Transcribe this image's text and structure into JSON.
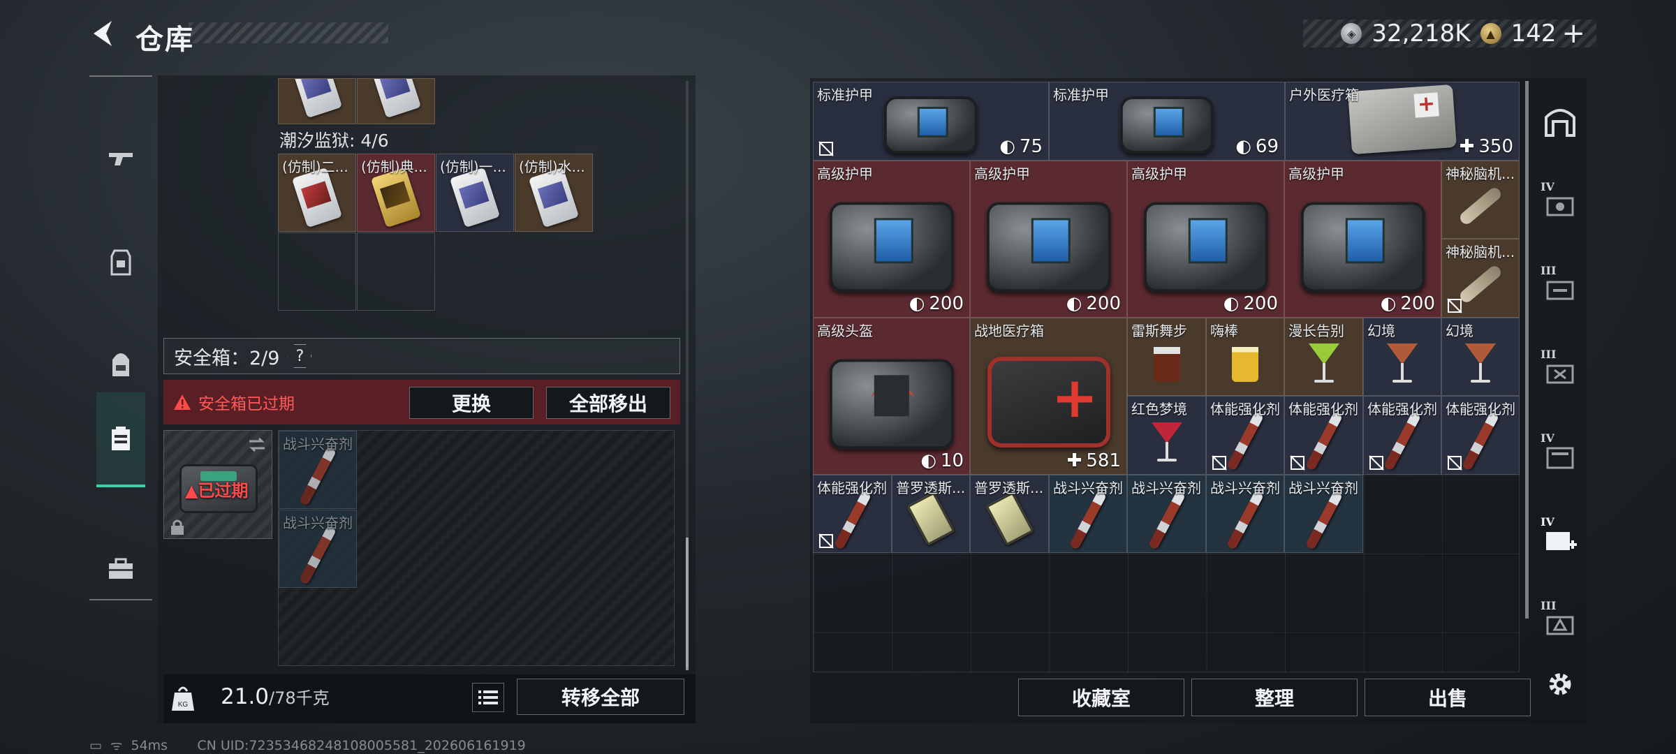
{
  "header": {
    "title": "仓库",
    "back_icon": "back-arrow-icon"
  },
  "currency": {
    "primary": {
      "icon": "silver-coin-icon",
      "value": "32,218K"
    },
    "secondary": {
      "icon": "gold-coin-icon",
      "value": "142"
    },
    "plus_label": "+"
  },
  "left_nav": {
    "items": [
      {
        "icon": "gun-icon",
        "active": false
      },
      {
        "icon": "armor-vest-icon",
        "active": false
      },
      {
        "icon": "backpack-icon",
        "active": false
      },
      {
        "icon": "safe-box-icon",
        "active": true
      },
      {
        "icon": "toolbox-icon",
        "active": false
      }
    ]
  },
  "container": {
    "prison_label": "潮汐监狱: 4/6",
    "top_cards": [
      "",
      ""
    ],
    "cards": [
      {
        "label": "(仿制)二...",
        "style": "red"
      },
      {
        "label": "(仿制)典...",
        "style": "gold"
      },
      {
        "label": "(仿制)一...",
        "style": "blue"
      },
      {
        "label": "(仿制)水...",
        "style": "blue"
      }
    ]
  },
  "safe": {
    "title": "安全箱：2/9",
    "help": "?",
    "expired_warning": "安全箱已过期",
    "replace_button": "更换",
    "remove_all_button": "全部移出",
    "item_expired_tag": "已过期",
    "items": [
      {
        "label": "战斗兴奋剂"
      },
      {
        "label": "战斗兴奋剂"
      }
    ]
  },
  "footer_left": {
    "weight_current": "21.0",
    "weight_max": "/78千克",
    "transfer_all_button": "转移全部"
  },
  "status": {
    "ping": "54ms",
    "uid": "CN UID:7235346824810800558​1_202606161919"
  },
  "stash": {
    "items": [
      {
        "label": "标准护甲",
        "value": "75",
        "value_icon": "shield-icon",
        "no_trade": true
      },
      {
        "label": "标准护甲",
        "value": "69",
        "value_icon": "shield-icon",
        "no_trade": false
      },
      {
        "label": "户外医疗箱",
        "value": "350",
        "value_icon": "plus-icon",
        "no_trade": false
      },
      {
        "label": "高级护甲",
        "value": "200",
        "value_icon": "shield-icon"
      },
      {
        "label": "高级护甲",
        "value": "200",
        "value_icon": "shield-icon"
      },
      {
        "label": "高级护甲",
        "value": "200",
        "value_icon": "shield-icon"
      },
      {
        "label": "高级护甲",
        "value": "200",
        "value_icon": "shield-icon"
      },
      {
        "label": "神秘脑机...",
        "value": "",
        "no_trade": false
      },
      {
        "label": "神秘脑机...",
        "value": "",
        "no_trade": true
      },
      {
        "label": "高级头盔",
        "value": "10",
        "value_icon": "shield-icon"
      },
      {
        "label": "战地医疗箱",
        "value": "581",
        "value_icon": "plus-icon"
      },
      {
        "label": "雷斯舞步"
      },
      {
        "label": "嗨棒"
      },
      {
        "label": "漫长告别"
      },
      {
        "label": "幻境"
      },
      {
        "label": "幻境"
      },
      {
        "label": "红色梦境"
      },
      {
        "label": "体能强化剂",
        "no_trade": true
      },
      {
        "label": "体能强化剂",
        "no_trade": true
      },
      {
        "label": "体能强化剂",
        "no_trade": true
      },
      {
        "label": "体能强化剂",
        "no_trade": true
      },
      {
        "label": "体能强化剂",
        "no_trade": true
      },
      {
        "label": "普罗透斯..."
      },
      {
        "label": "普罗透斯..."
      },
      {
        "label": "战斗兴奋剂"
      },
      {
        "label": "战斗兴奋剂"
      },
      {
        "label": "战斗兴奋剂"
      },
      {
        "label": "战斗兴奋剂"
      }
    ]
  },
  "stash_footer": {
    "collection_button": "收藏室",
    "sort_button": "整理",
    "sell_button": "出售"
  },
  "side_rail": {
    "items": [
      {
        "icon": "vault-icon",
        "tier": ""
      },
      {
        "icon": "stash-tier-4-icon",
        "tier": "IV"
      },
      {
        "icon": "stash-tier-3-icon",
        "tier": "III"
      },
      {
        "icon": "stash-tier-3b-icon",
        "tier": "III"
      },
      {
        "icon": "stash-tier-4b-icon",
        "tier": "IV"
      },
      {
        "icon": "stash-add-icon",
        "tier": "IV"
      },
      {
        "icon": "stash-tier-3c-icon",
        "tier": "III"
      }
    ],
    "settings_icon": "gear-icon"
  },
  "colors": {
    "accent_green": "#3ccfa8",
    "warning_red": "#ff5a5a",
    "expired_bg": "#5a1f25"
  }
}
